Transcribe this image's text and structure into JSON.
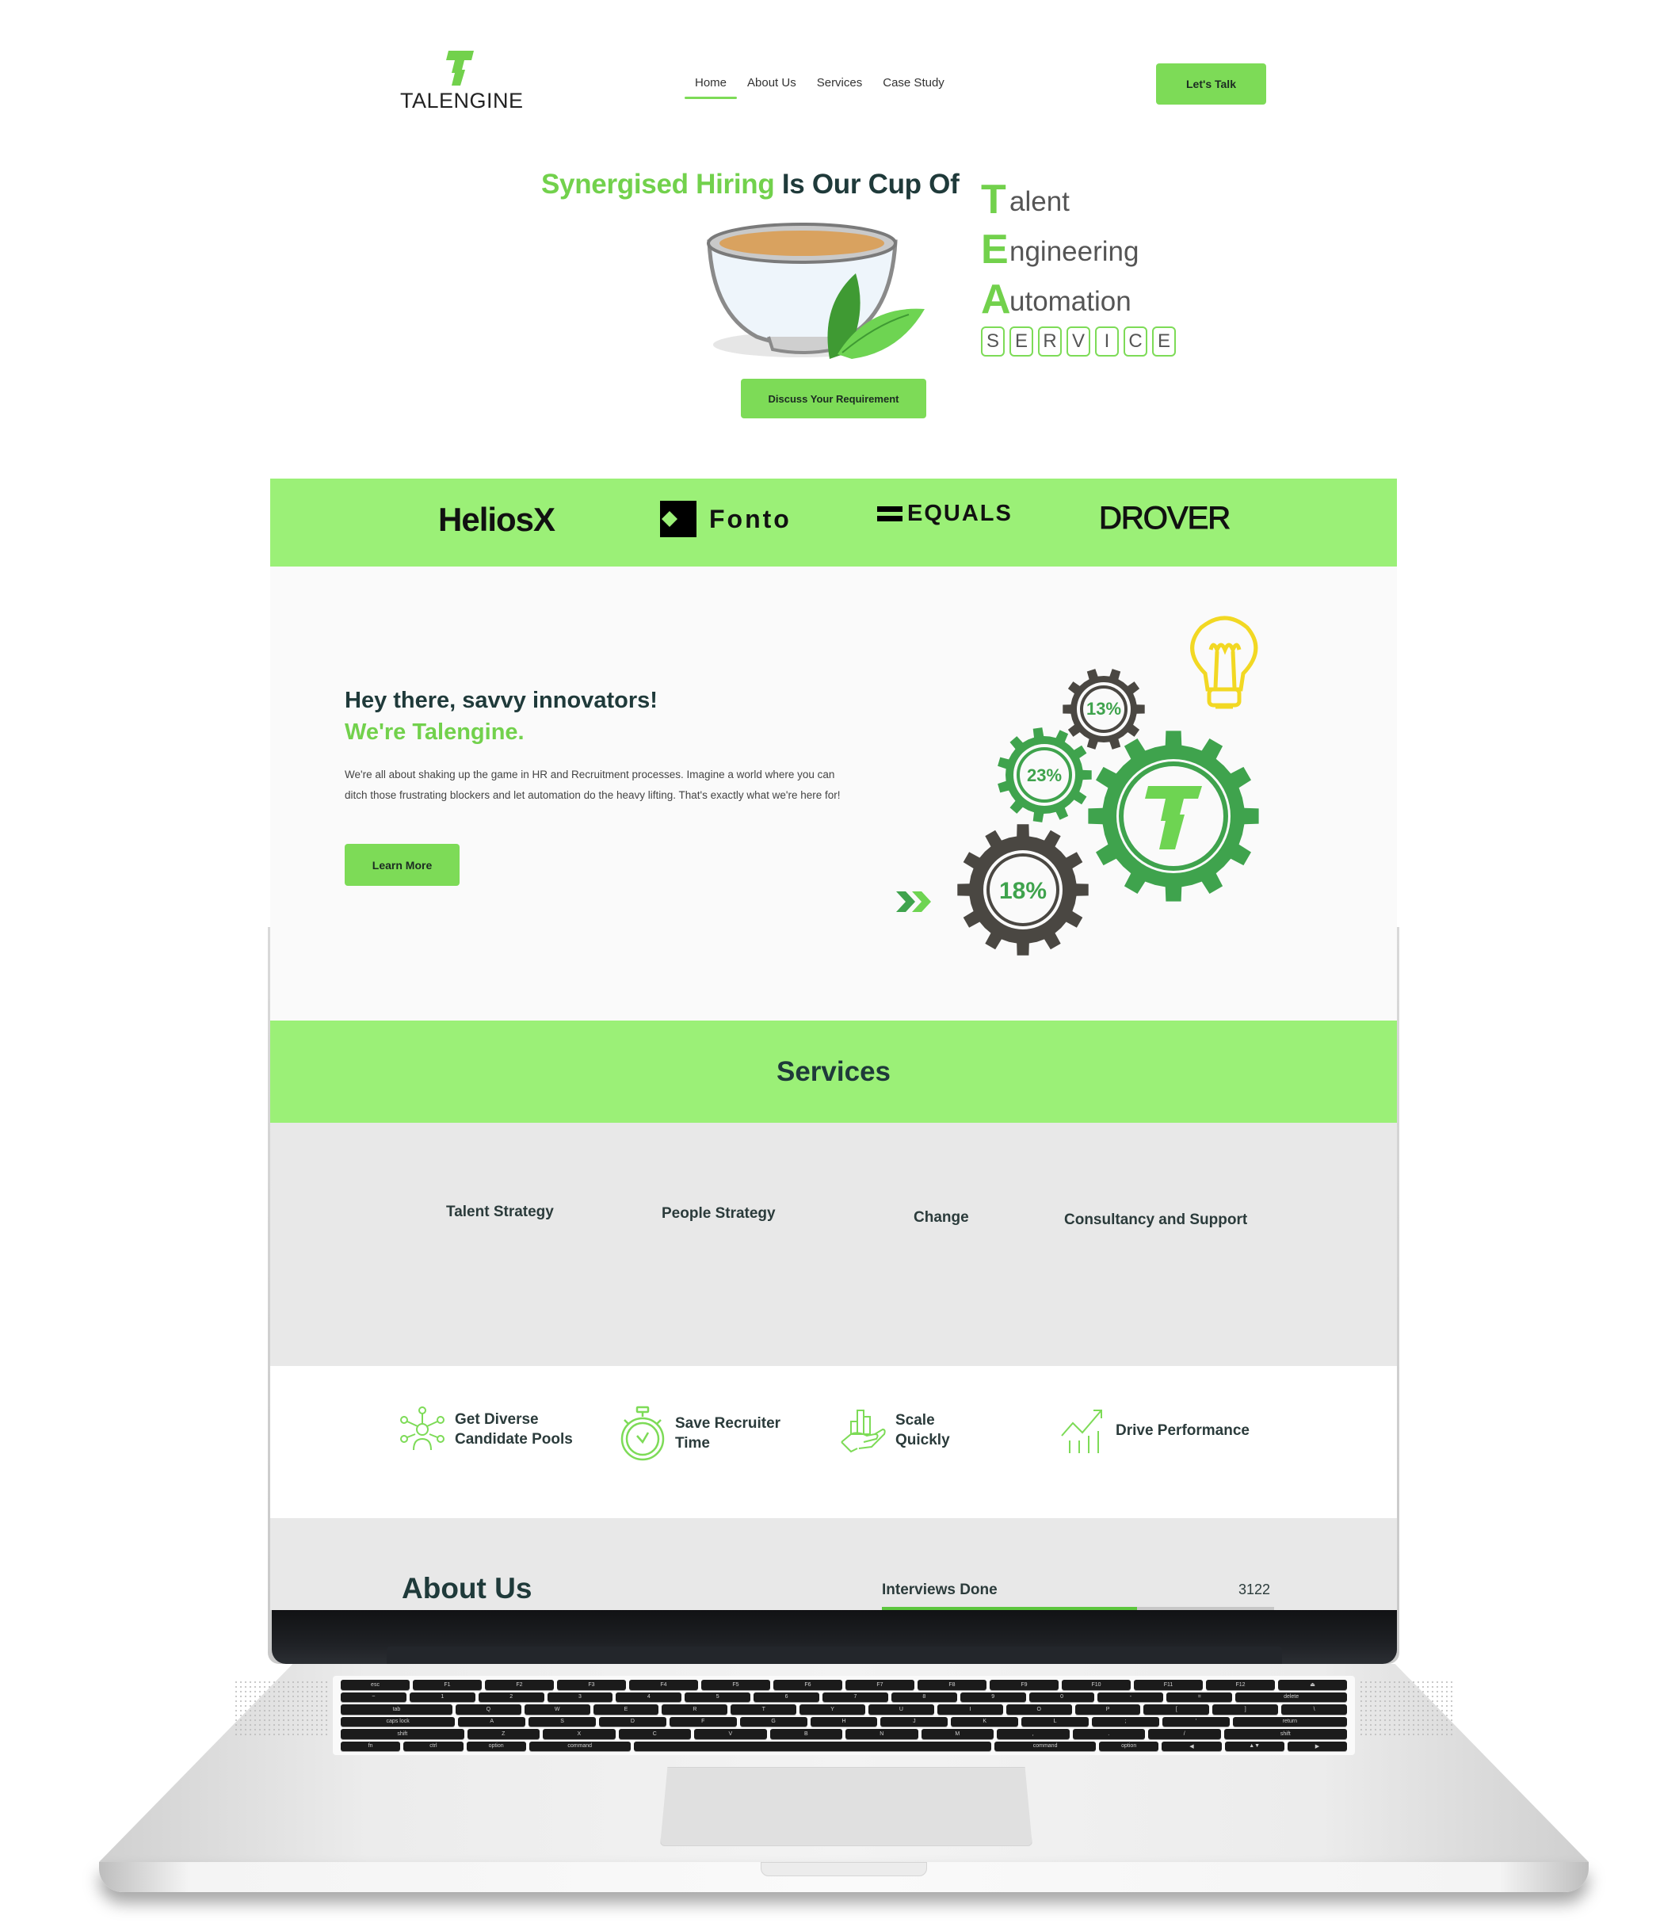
{
  "brand": {
    "name": "TALENGINE",
    "accent_color": "#7ddb57",
    "band_color": "#9bf077",
    "dark_text_color": "#1f3a3a"
  },
  "nav": {
    "items": [
      {
        "label": "Home",
        "active": true
      },
      {
        "label": "About Us",
        "active": false
      },
      {
        "label": "Services",
        "active": false
      },
      {
        "label": "Case Study",
        "active": false
      }
    ],
    "cta_label": "Let's Talk"
  },
  "hero": {
    "headline_green": "Synergised Hiring",
    "headline_dark": "Is Our Cup Of",
    "tea": [
      {
        "cap": "T",
        "rest": "alent"
      },
      {
        "cap": "E",
        "rest": "ngineering"
      },
      {
        "cap": "A",
        "rest": "utomation"
      }
    ],
    "service_letters": [
      "S",
      "E",
      "R",
      "V",
      "I",
      "C",
      "E"
    ],
    "button_label": "Discuss Your Requirement",
    "image": "tea-cup-with-leaves"
  },
  "clients": [
    {
      "name": "HeliosX",
      "icon": "heliosx-logo"
    },
    {
      "name": "Fonto",
      "icon": "fonto-logo"
    },
    {
      "name": "EQUALS",
      "icon": "equals-logo"
    },
    {
      "name": "DROVER",
      "icon": "drover-logo"
    }
  ],
  "intro": {
    "heading": "Hey there, savvy innovators!",
    "subheading": "We're Talengine.",
    "body": "We're all about shaking up the game in HR and Recruitment processes. Imagine a world where you can ditch those frustrating blockers and let automation do the heavy lifting. That's exactly what we're here for!",
    "button_label": "Learn More",
    "gear_labels": [
      "13%",
      "23%",
      "18%"
    ],
    "gear_center_letter": "T"
  },
  "services": {
    "title": "Services",
    "items": [
      "Talent Strategy",
      "People Strategy",
      "Change",
      "Consultancy and Support"
    ]
  },
  "benefits": [
    {
      "label_line1": "Get Diverse",
      "label_line2": "Candidate Pools",
      "icon": "network-people-icon"
    },
    {
      "label_line1": "Save Recruiter",
      "label_line2": "Time",
      "icon": "stopwatch-icon"
    },
    {
      "label_line1": "Scale",
      "label_line2": "Quickly",
      "icon": "hand-growth-icon"
    },
    {
      "label_line1": "Drive Performance",
      "label_line2": "",
      "icon": "trend-chart-icon"
    }
  ],
  "about": {
    "title": "About Us",
    "stats": [
      {
        "label": "Interviews Done",
        "value": "3122",
        "progress_percent": 65
      }
    ]
  },
  "keyboard": {
    "rows": [
      [
        "esc",
        "F1",
        "F2",
        "F3",
        "F4",
        "F5",
        "F6",
        "F7",
        "F8",
        "F9",
        "F10",
        "F11",
        "F12",
        "⏏"
      ],
      [
        "~",
        "1",
        "2",
        "3",
        "4",
        "5",
        "6",
        "7",
        "8",
        "9",
        "0",
        "-",
        "=",
        "delete"
      ],
      [
        "tab",
        "Q",
        "W",
        "E",
        "R",
        "T",
        "Y",
        "U",
        "I",
        "O",
        "P",
        "[",
        "]",
        "\\"
      ],
      [
        "caps lock",
        "A",
        "S",
        "D",
        "F",
        "G",
        "H",
        "J",
        "K",
        "L",
        ";",
        "'",
        "return"
      ],
      [
        "shift",
        "Z",
        "X",
        "C",
        "V",
        "B",
        "N",
        "M",
        ",",
        ".",
        "/",
        "shift"
      ],
      [
        "fn",
        "ctrl",
        "option",
        "command",
        " ",
        "command",
        "option",
        "◀",
        "▲▼",
        "▶"
      ]
    ]
  }
}
